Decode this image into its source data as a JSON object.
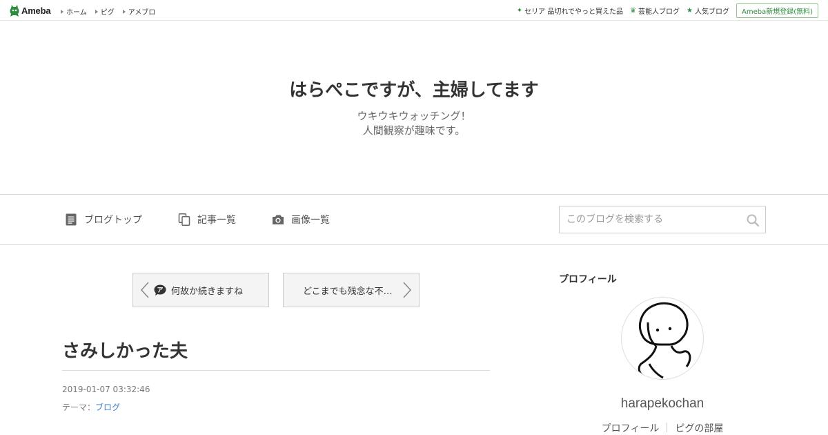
{
  "topbar": {
    "logo_text": "Ameba",
    "nav": [
      "ホーム",
      "ピグ",
      "アメブロ"
    ],
    "right_links": [
      {
        "icon": "sparkle-icon",
        "label": "セリア 品切れでやっと買えた品"
      },
      {
        "icon": "crown-icon",
        "label": "芸能人ブログ"
      },
      {
        "icon": "star-icon",
        "label": "人気ブログ"
      }
    ],
    "register_label": "Ameba新規登録(無料)"
  },
  "header": {
    "title": "はらぺこですが、主婦してます",
    "description_line1": "ウキウキウォッチング！",
    "description_line2": "人間観察が趣味です。"
  },
  "navbar": {
    "items": [
      {
        "icon": "document-icon",
        "label": "ブログトップ"
      },
      {
        "icon": "copy-icon",
        "label": "記事一覧"
      },
      {
        "icon": "camera-icon",
        "label": "画像一覧"
      }
    ],
    "search_placeholder": "このブログを検索する"
  },
  "article": {
    "prev_label": "何故か続きますね",
    "next_label": "どこまでも残念な不…",
    "title": "さみしかった夫",
    "date": "2019-01-07 03:32:46",
    "theme_prefix": "テーマ：",
    "theme_link": "ブログ"
  },
  "sidebar": {
    "heading": "プロフィール",
    "name": "harapekochan",
    "links": [
      "プロフィール",
      "ピグの部屋"
    ]
  },
  "colors": {
    "brand_green": "#2d8c3c",
    "link_blue": "#3a7ccb"
  }
}
